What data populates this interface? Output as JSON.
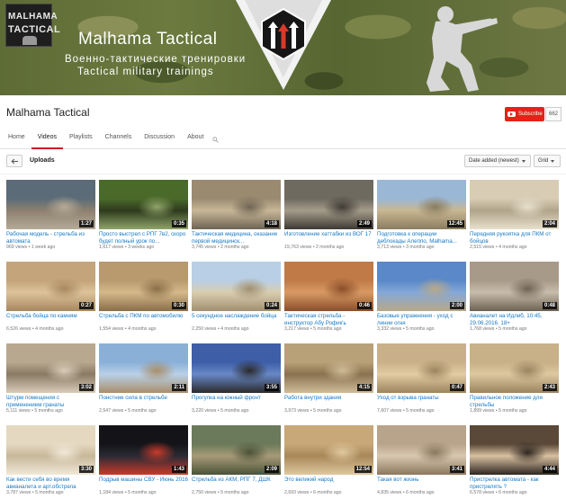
{
  "banner": {
    "logo_line1": "MALHAMA",
    "logo_line2": "TACTICAL",
    "brand": "Malhama Tactical",
    "subtitle_ru": "Военно-тактические тренировки",
    "subtitle_en": "Tactical military trainings"
  },
  "channel": {
    "title": "Malhama Tactical",
    "subscribe_label": "Subscribe",
    "subscriber_count": "662"
  },
  "tabs": [
    {
      "label": "Home",
      "active": false
    },
    {
      "label": "Videos",
      "active": true
    },
    {
      "label": "Playlists",
      "active": false
    },
    {
      "label": "Channels",
      "active": false
    },
    {
      "label": "Discussion",
      "active": false
    },
    {
      "label": "About",
      "active": false
    }
  ],
  "uploads": {
    "title": "Uploads",
    "sort_label": "Date added (newest)",
    "view_label": "Grid"
  },
  "videos": [
    {
      "title": "Рабочая модель - стрельба из автомата",
      "views": "969 views",
      "age": "1 week ago",
      "duration": "1:27",
      "colors": [
        "#5b6b78",
        "#8d8070",
        "#b5aa96"
      ]
    },
    {
      "title": "Просто выстрел с РПГ 7в2, скоро будет полный урок по...",
      "views": "1,617 views",
      "age": "3 weeks ago",
      "duration": "0:35",
      "colors": [
        "#4a6a2a",
        "#2e3a1c",
        "#8fa46a"
      ]
    },
    {
      "title": "Тактическая медицина, оказание первой медицинск...",
      "views": "3,745 views",
      "age": "2 months ago",
      "duration": "4:18",
      "colors": [
        "#9a8a70",
        "#c8b898",
        "#6e6454"
      ]
    },
    {
      "title": "Изготовление хаттабки из ВОГ 17",
      "views": "19,763 views",
      "age": "2 months ago",
      "duration": "2:49",
      "colors": [
        "#6e6a60",
        "#a59c8a",
        "#3e3a34"
      ]
    },
    {
      "title": "Подготовка к операции деблокады Алеппо, Malhama...",
      "views": "3,713 views",
      "age": "3 months ago",
      "duration": "12:45",
      "colors": [
        "#9ab7d6",
        "#c9b792",
        "#8a7d60"
      ]
    },
    {
      "title": "Передняя рукоятка для ПКМ от бойцов",
      "views": "2,515 views",
      "age": "4 months ago",
      "duration": "2:04",
      "colors": [
        "#d8ccb4",
        "#b0a48a",
        "#e8e0cc"
      ]
    },
    {
      "title": "Стрельба бойца по камням",
      "views": "6,526 views",
      "age": "4 months ago",
      "duration": "0:27",
      "colors": [
        "#c4a47a",
        "#dcc39a",
        "#a8885e"
      ]
    },
    {
      "title": "Стрельба с ПКМ по автомобилю",
      "views": "1,554 views",
      "age": "4 months ago",
      "duration": "0:30",
      "colors": [
        "#b89a6e",
        "#d4b98a",
        "#8a6e48"
      ]
    },
    {
      "title": "5 секундное наслаждение бойца",
      "views": "2,250 views",
      "age": "4 months ago",
      "duration": "0:24",
      "colors": [
        "#b9cfe6",
        "#d9cdb0",
        "#a09070"
      ]
    },
    {
      "title": "Тактическая стрельба - инструктор Абу Рофик'ь",
      "views": "3,217 views",
      "age": "5 months ago",
      "duration": "0:46",
      "colors": [
        "#c07a48",
        "#d89a64",
        "#8a4e2a"
      ]
    },
    {
      "title": "Базовые упражнения - уход с линии огня",
      "views": "3,332 views",
      "age": "5 months ago",
      "duration": "2:00",
      "colors": [
        "#5a88c8",
        "#84a8d8",
        "#b8a888"
      ]
    },
    {
      "title": "Авианалет на Идлиб, 10:45, 29.06.2016. 18+",
      "views": "1,768 views",
      "age": "5 months ago",
      "duration": "0:48",
      "colors": [
        "#a89a88",
        "#c8bcac",
        "#6e6254"
      ]
    },
    {
      "title": "Штурм помещения с применением гранаты",
      "views": "5,111 views",
      "age": "5 months ago",
      "duration": "3:02",
      "colors": [
        "#b8a890",
        "#8a7a64",
        "#d8ccb8"
      ]
    },
    {
      "title": "Понстние сила в стрельбе",
      "views": "2,547 views",
      "age": "5 months ago",
      "duration": "2:11",
      "colors": [
        "#8ab0d8",
        "#b9d0e8",
        "#a88e6a"
      ]
    },
    {
      "title": "Прогулка на южный фронт",
      "views": "3,220 views",
      "age": "5 months ago",
      "duration": "3:55",
      "colors": [
        "#3e5ea8",
        "#6888c8",
        "#2a2a2a"
      ]
    },
    {
      "title": "Работа внутри здания",
      "views": "3,973 views",
      "age": "5 months ago",
      "duration": "4:15",
      "colors": [
        "#b8a078",
        "#8a7250",
        "#d0bc98"
      ]
    },
    {
      "title": "Уход от взрыва гранаты",
      "views": "7,607 views",
      "age": "5 months ago",
      "duration": "0:47",
      "colors": [
        "#c9b08a",
        "#e2cca4",
        "#9c845e"
      ]
    },
    {
      "title": "Правильное положение для стрельбы",
      "views": "1,899 views",
      "age": "5 months ago",
      "duration": "2:43",
      "colors": [
        "#c8b088",
        "#dcc8a0",
        "#9a8460"
      ]
    },
    {
      "title": "Как вести себя во время авианалета и арт.обстрела",
      "views": "3,787 views",
      "age": "5 months ago",
      "duration": "3:30",
      "colors": [
        "#e4d8c0",
        "#c8b89a",
        "#f0e8d8"
      ]
    },
    {
      "title": "Подрыв машины СВУ - Июнь 2016",
      "views": "1,184 views",
      "age": "5 months ago",
      "duration": "1:43",
      "colors": [
        "#141418",
        "#2a2a34",
        "#c83a2a"
      ]
    },
    {
      "title": "Стрельба из АКМ, РПГ 7, ДШК",
      "views": "2,750 views",
      "age": "5 months ago",
      "duration": "2:09",
      "colors": [
        "#6a7a5a",
        "#a89a78",
        "#4a5238"
      ]
    },
    {
      "title": "Это великий народ",
      "views": "2,693 views",
      "age": "6 months ago",
      "duration": "12:54",
      "colors": [
        "#c8a878",
        "#a8885a",
        "#e0c89e"
      ]
    },
    {
      "title": "Такая вот жизнь",
      "views": "4,835 views",
      "age": "6 months ago",
      "duration": "3:41",
      "colors": [
        "#b8a48a",
        "#d8c8b0",
        "#8a785e"
      ]
    },
    {
      "title": "Пристрелка автомата - как пристрелять ?",
      "views": "6,578 views",
      "age": "6 months ago",
      "duration": "4:44",
      "colors": [
        "#5a4838",
        "#d8c0a0",
        "#2e2620"
      ]
    }
  ]
}
